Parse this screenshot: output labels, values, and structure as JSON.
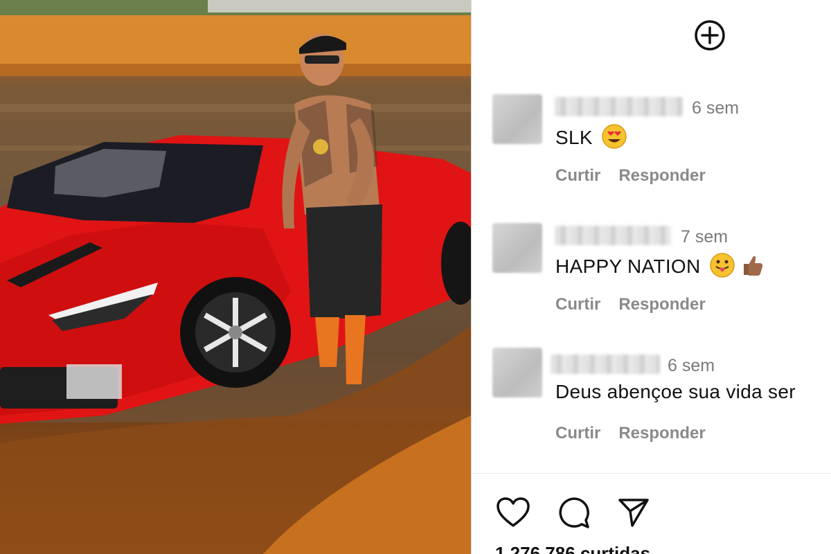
{
  "comments": [
    {
      "time": "6 sem",
      "text": "SLK",
      "emoji": "heart-eyes",
      "like": "Curtir",
      "reply": "Responder"
    },
    {
      "time": "7 sem",
      "text": "HAPPY NATION",
      "emoji": "tongue-out-and-thumbs-up",
      "like": "Curtir",
      "reply": "Responder"
    },
    {
      "time": "6 sem",
      "text": "Deus abençoe sua vida ser",
      "like": "Curtir",
      "reply": "Responder"
    }
  ],
  "likes": "1.276.786 curtidas",
  "icons": [
    "plus-circle-icon",
    "heart-icon",
    "comment-icon",
    "share-icon"
  ]
}
